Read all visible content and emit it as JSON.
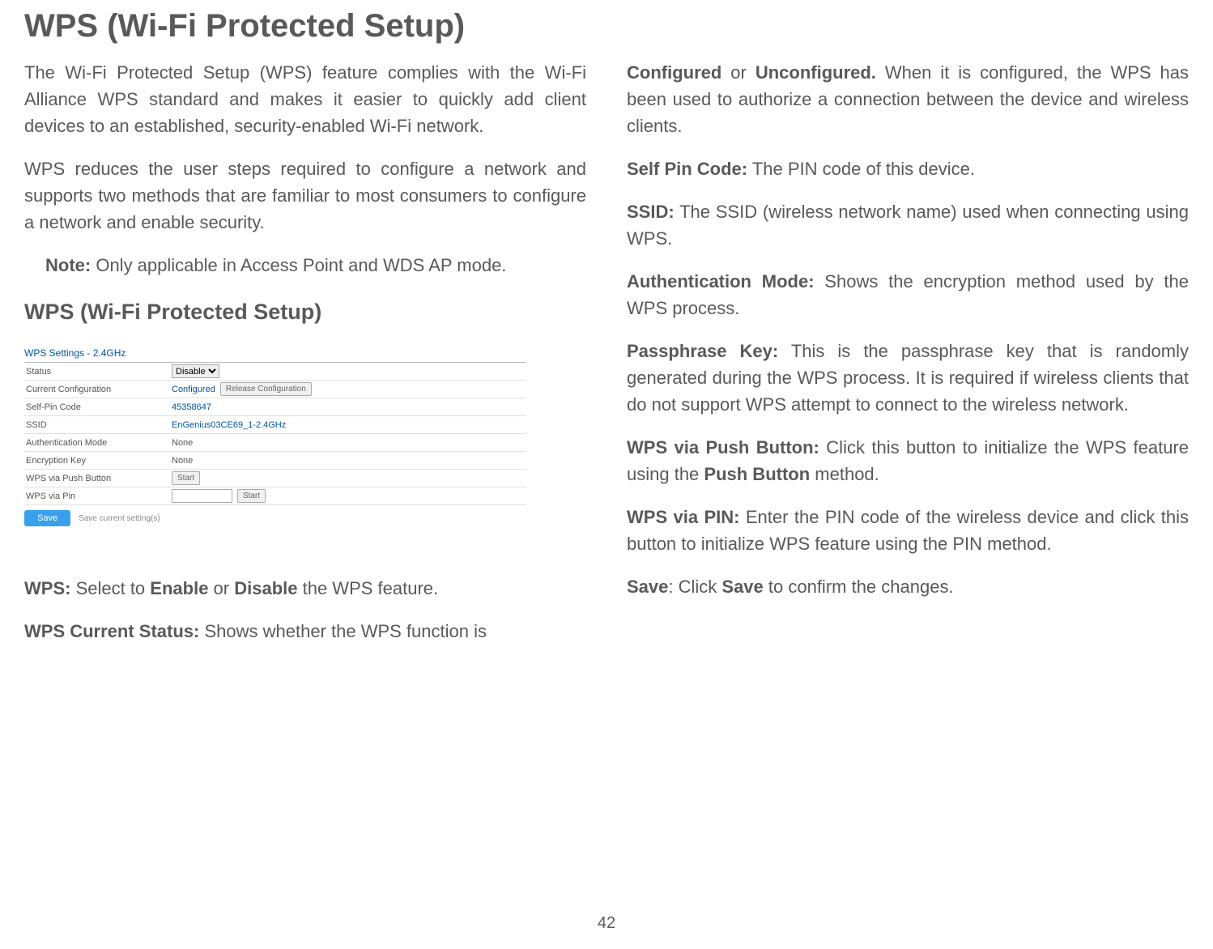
{
  "title": "WPS (Wi-Fi Protected Setup)",
  "page_number": "42",
  "col1": {
    "p1": "The Wi-Fi Protected Setup (WPS) feature complies with the Wi-Fi Alliance WPS standard and makes it easier to quickly add client devices to an established, security-enabled Wi-Fi network.",
    "p2": "WPS reduces the user steps required to configure a network and supports two methods that are familiar to most consumers to configure a network and enable security.",
    "note_label": "Note:",
    "note_text": " Only applicable in Access Point and WDS AP mode.",
    "subtitle": "WPS (Wi-Fi Protected Setup)",
    "wps_label": "WPS:",
    "wps_text": " Select to ",
    "wps_enable": "Enable",
    "wps_or": " or ",
    "wps_disable": "Disable",
    "wps_end": " the WPS feature.",
    "cs_label": "WPS Current Status:",
    "cs_text": " Shows whether the WPS function is "
  },
  "col2": {
    "cfg_configured": "Configured",
    "cfg_or": " or ",
    "cfg_unconfigured": "Unconfigured.",
    "cfg_text": " When it is configured, the WPS has been used to authorize a connection between the device and wireless clients.",
    "spc_label": "Self Pin Code:",
    "spc_text": " The PIN code of this device.",
    "ssid_label": "SSID:",
    "ssid_text": " The SSID (wireless network name) used when connecting using WPS.",
    "am_label": "Authentication Mode:",
    "am_text": " Shows the encryption method used by the WPS process.",
    "pk_label": "Passphrase Key:",
    "pk_text": " This is the passphrase key that is randomly generated during the WPS process. It is required if wireless clients that do not support WPS attempt to connect to the wireless network.",
    "pb_label": "WPS via Push Button:",
    "pb_text": " Click this button to initialize the WPS feature using the ",
    "pb_pushbutton": "Push Button",
    "pb_end": " method.",
    "pin_label": "WPS via PIN:",
    "pin_text": " Enter the PIN code of the wireless device and click this button to initialize WPS feature using the PIN method.",
    "save_label": "Save",
    "save_text1": ": Click ",
    "save_bold": "Save",
    "save_text2": " to confirm the changes."
  },
  "panel": {
    "header": "WPS Settings - 2.4GHz",
    "rows": {
      "status": {
        "label": "Status",
        "value": "Disable"
      },
      "current_config": {
        "label": "Current Configuration",
        "value": "Configured",
        "button": "Release Configuration"
      },
      "self_pin": {
        "label": "Self-Pin Code",
        "value": "45358647"
      },
      "ssid": {
        "label": "SSID",
        "value": "EnGenius03CE69_1-2.4GHz"
      },
      "auth": {
        "label": "Authentication Mode",
        "value": "None"
      },
      "enc": {
        "label": "Encryption Key",
        "value": "None"
      },
      "push": {
        "label": "WPS via Push Button",
        "button": "Start"
      },
      "pin": {
        "label": "WPS via Pin",
        "button": "Start"
      }
    },
    "save_button": "Save",
    "save_hint": "Save current setting(s)"
  }
}
